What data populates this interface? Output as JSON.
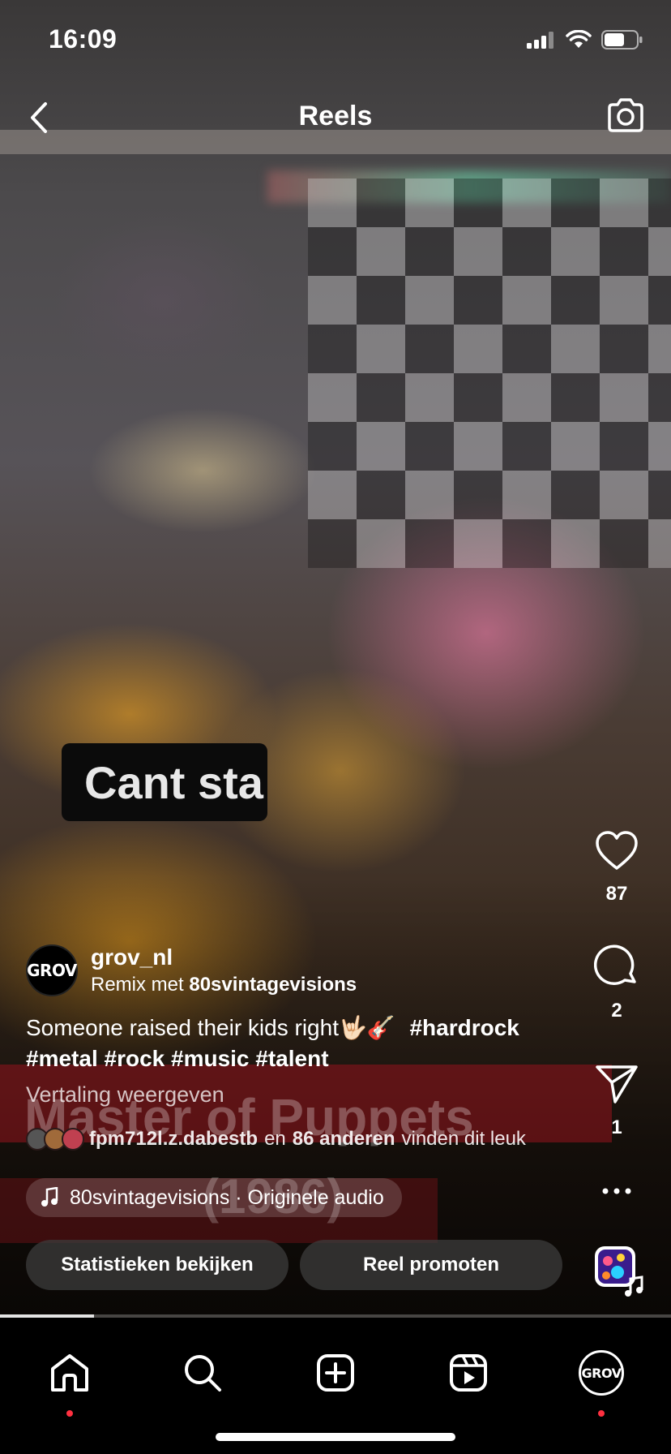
{
  "status_bar": {
    "time": "16:09"
  },
  "header": {
    "title": "Reels"
  },
  "video_overlay": {
    "caption_text": "Cant sta",
    "ghost_title": "Master of Puppets",
    "ghost_year": "(1986)"
  },
  "actions": {
    "likes_count": "87",
    "comments_count": "2",
    "shares_count": "1"
  },
  "author": {
    "avatar_text": "GROV",
    "username": "grov_nl",
    "remix_prefix": "Remix met",
    "remix_account": "80svintagevisions"
  },
  "description": {
    "text": "Someone raised their kids right🤟🏻🎸",
    "hashtags_line1": "#hardrock",
    "hashtags_line2": "#metal #rock #music #talent"
  },
  "translate_label": "Vertaling weergeven",
  "liked_by": {
    "user": "fpm712l.z.dabestb",
    "connector": "en",
    "others": "86 anderen",
    "suffix": "vinden dit leuk"
  },
  "audio": {
    "label": "80svintagevisions · Originele audio"
  },
  "buttons": {
    "insights": "Statistieken bekijken",
    "promote": "Reel promoten"
  },
  "progress": {
    "fraction": 0.14
  },
  "colors": {
    "notification_dot": "#ff3040"
  },
  "tabbar": {
    "items": [
      {
        "name": "home-icon"
      },
      {
        "name": "search-icon"
      },
      {
        "name": "create-icon"
      },
      {
        "name": "reels-icon"
      },
      {
        "name": "profile-avatar",
        "text": "GROV"
      }
    ]
  }
}
